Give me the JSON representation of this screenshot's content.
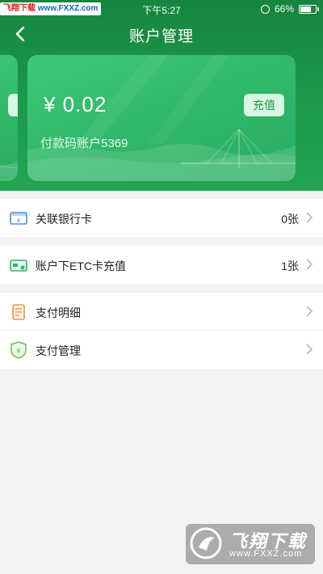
{
  "status_bar": {
    "source_brand": "飞翔下载",
    "source_url": "www.FXXZ.com",
    "time": "下午5:27",
    "battery": "66%",
    "battery_level": 0.66
  },
  "nav": {
    "title": "账户管理",
    "back_icon": "chevron-left-icon"
  },
  "card": {
    "balance": "¥ 0.02",
    "recharge_label": "充值",
    "account_label": "付款码账户5369"
  },
  "menu_groups": [
    [
      {
        "icon": "bank-card-icon",
        "label": "关联银行卡",
        "count": "0张"
      }
    ],
    [
      {
        "icon": "etc-card-icon",
        "label": "账户下ETC卡充值",
        "count": "1张"
      }
    ],
    [
      {
        "icon": "payment-detail-icon",
        "label": "支付明细",
        "count": ""
      },
      {
        "icon": "shield-yuan-icon",
        "label": "支付管理",
        "count": ""
      }
    ]
  ],
  "watermark": {
    "name": "飞翔下载",
    "url": "www.FXXZ.com"
  },
  "colors": {
    "header_green": "#1c9a4a",
    "card_green": "#34bb6c",
    "background": "#f3f3f3"
  }
}
